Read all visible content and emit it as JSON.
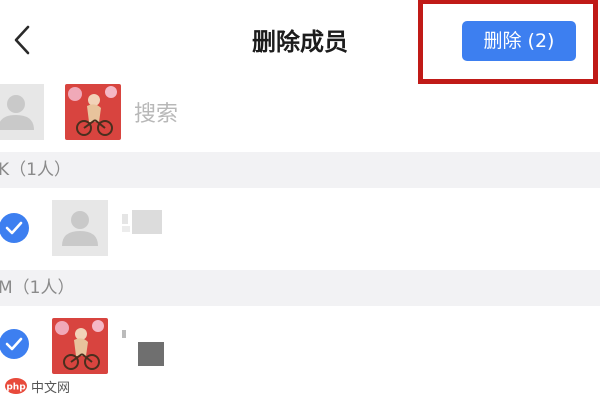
{
  "header": {
    "title": "删除成员",
    "back_icon": "chevron-left-icon",
    "delete_button_label": "删除 (2)"
  },
  "search": {
    "placeholder": "搜索",
    "selected_avatars": [
      "default-avatar",
      "photo-avatar"
    ]
  },
  "sections": [
    {
      "header": "K（1人）",
      "members": [
        {
          "avatar": "default-avatar",
          "checked": true,
          "name": ""
        }
      ]
    },
    {
      "header": "M（1人）",
      "members": [
        {
          "avatar": "photo-avatar",
          "checked": true,
          "name": ""
        }
      ]
    }
  ],
  "watermark": {
    "logo_text": "php",
    "text": "中文网"
  },
  "colors": {
    "primary_blue": "#3d7ff0",
    "highlight_red": "#c01a17",
    "section_bg": "#f2f2f4",
    "section_text": "#8a8a8a",
    "placeholder_text": "#b8b8b8"
  }
}
